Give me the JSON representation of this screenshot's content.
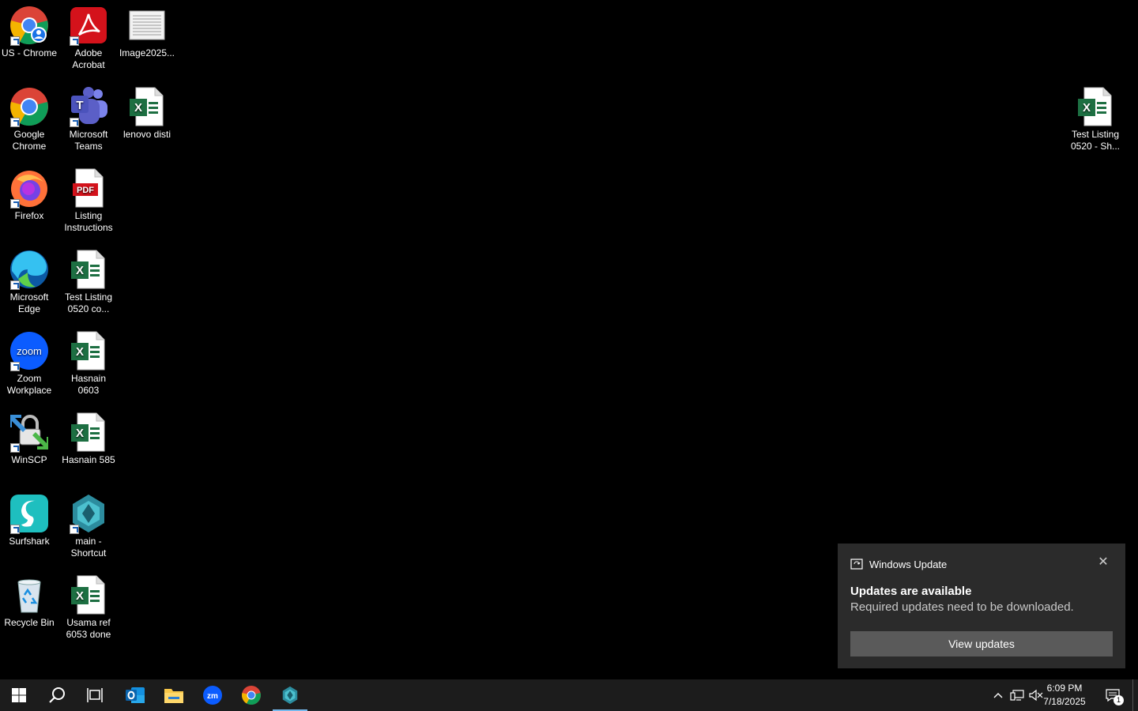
{
  "desktop": {
    "icons": [
      {
        "label": "US - Chrome"
      },
      {
        "label": "Adobe\nAcrobat"
      },
      {
        "label": "Image2025..."
      },
      {
        "label": "Google\nChrome"
      },
      {
        "label": "Microsoft\nTeams"
      },
      {
        "label": "lenovo disti"
      },
      {
        "label": "Test Listing\n0520 - Sh..."
      },
      {
        "label": "Firefox"
      },
      {
        "label": "Listing\nInstructions"
      },
      {
        "label": "Microsoft\nEdge"
      },
      {
        "label": "Test Listing\n0520 co..."
      },
      {
        "label": "Zoom\nWorkplace"
      },
      {
        "label": "Hasnain 0603"
      },
      {
        "label": "WinSCP"
      },
      {
        "label": "Hasnain 585"
      },
      {
        "label": "Surfshark"
      },
      {
        "label": "main -\nShortcut"
      },
      {
        "label": "Recycle Bin"
      },
      {
        "label": "Usama ref\n6053 done"
      }
    ],
    "icon_texts": {
      "pdf": "PDF",
      "zoom": "zoom",
      "teams": "T",
      "excel": "X"
    }
  },
  "toast": {
    "app_name": "Windows Update",
    "title": "Updates are available",
    "body": "Required updates need to be downloaded.",
    "button_label": "View updates",
    "close_glyph": "✕"
  },
  "taskbar": {
    "pinned": [
      "Start",
      "Search",
      "Task View",
      "Outlook",
      "File Explorer",
      "Zoom",
      "Google Chrome",
      "main"
    ],
    "zoom_text": "zm",
    "tray": {
      "chevron_glyph": "^",
      "time": "6:09 PM",
      "date": "7/18/2025",
      "notification_count": "1"
    },
    "active_indicator_color": "#76b9ed"
  }
}
